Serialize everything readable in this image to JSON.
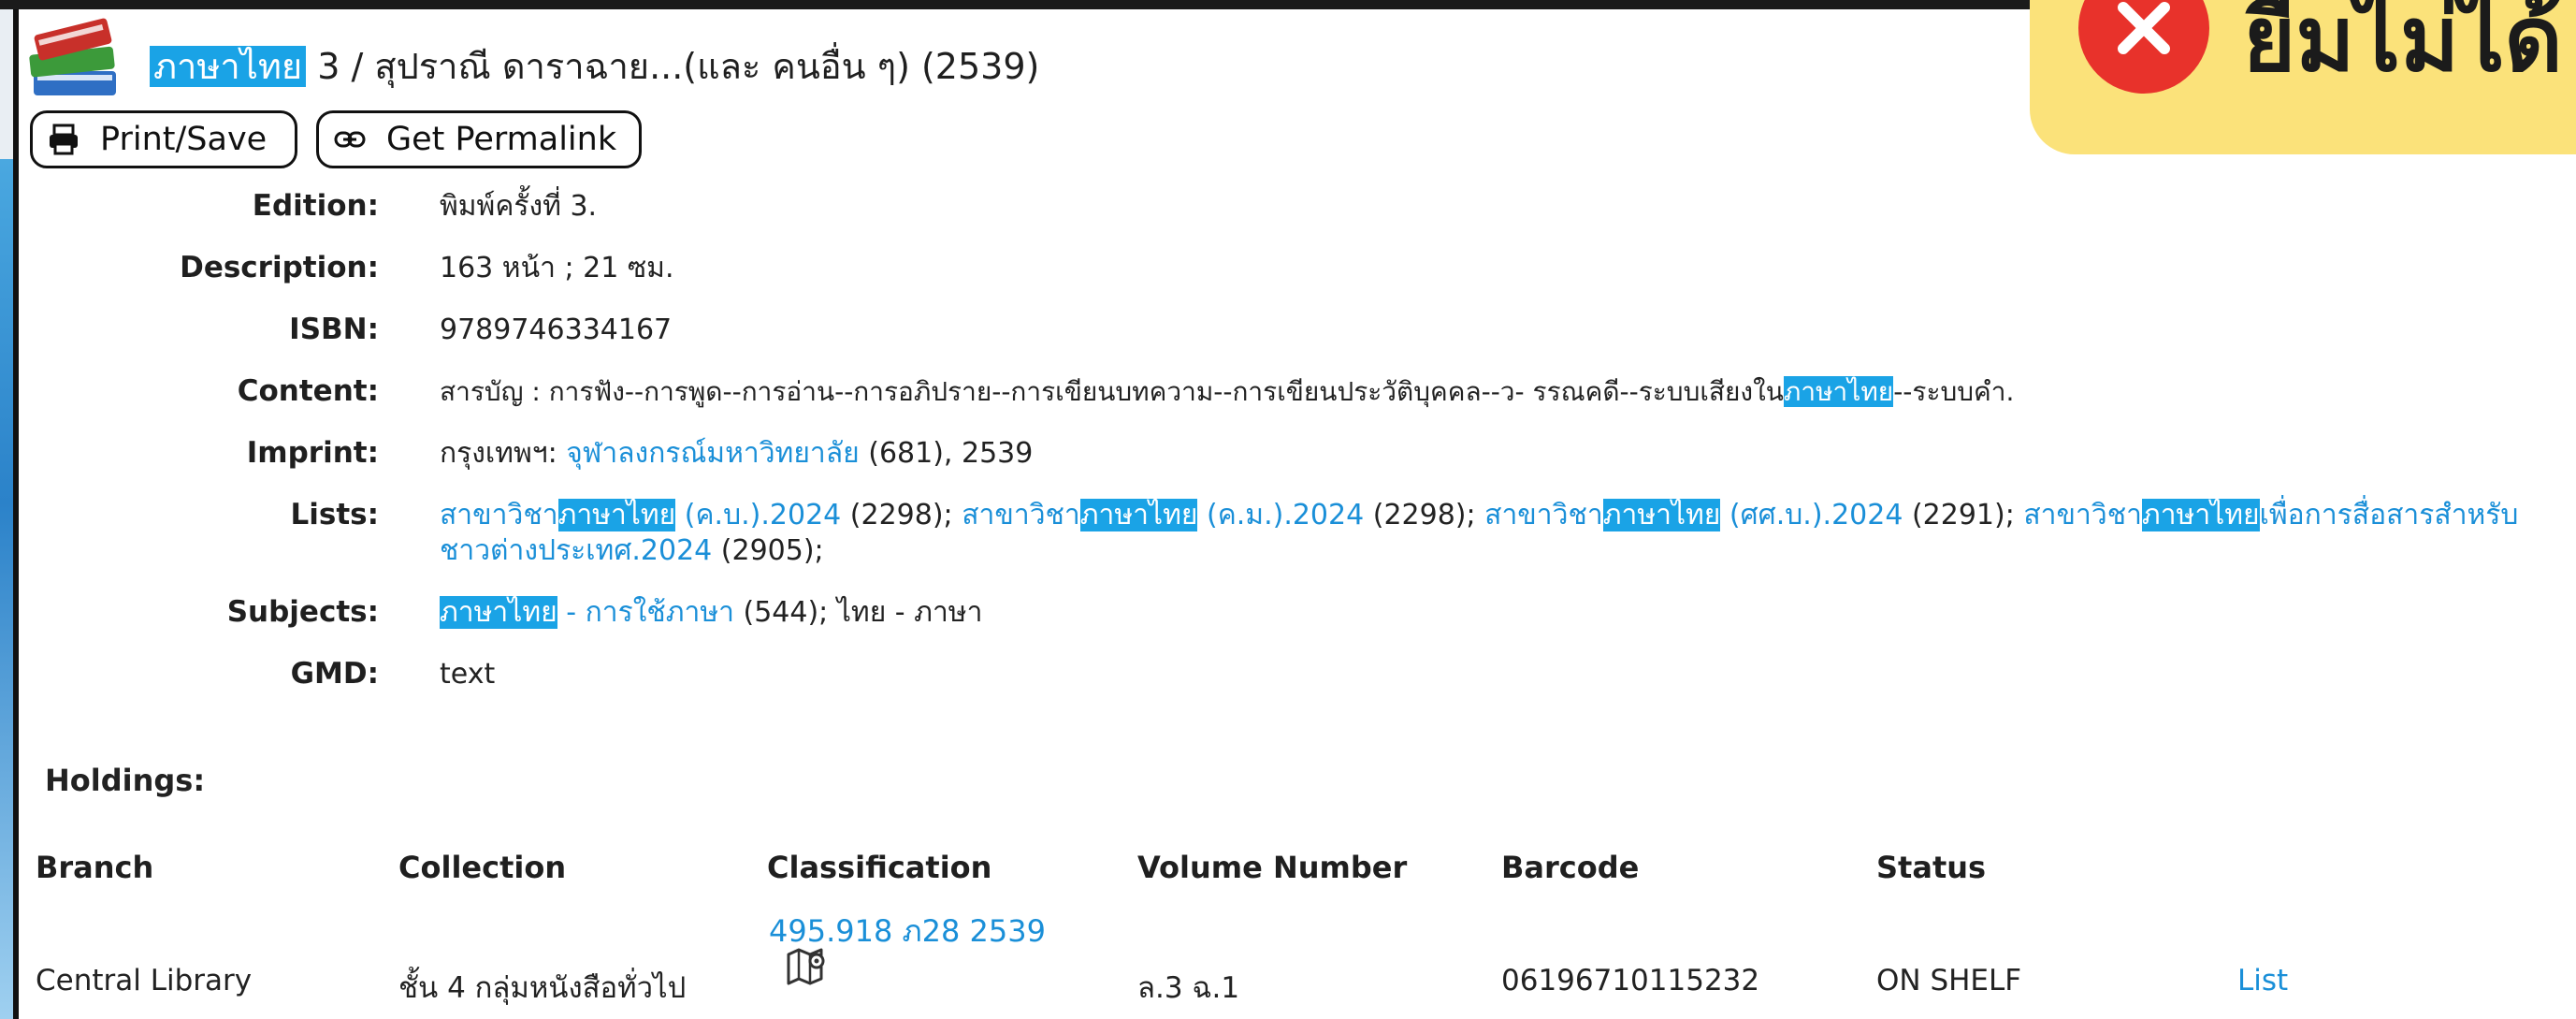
{
  "record": {
    "title_highlight": "ภาษาไทย",
    "title_rest": " 3  /  สุปราณี ดาราฉาย...(และ คนอื่น ๆ)  (2539)"
  },
  "buttons": {
    "print_label": "Print/Save",
    "permalink_label": "Get Permalink"
  },
  "fields": {
    "edition_label": "Edition:",
    "edition_value": "พิมพ์ครั้งที่ 3.",
    "description_label": "Description:",
    "description_value": "163 หน้า ; 21 ซม.",
    "isbn_label": "ISBN:",
    "isbn_value": "9789746334167",
    "content_label": "Content:",
    "content_value_pre": "สารบัญ : การฟัง--การพูด--การอ่าน--การอภิปราย--การเขียนบทความ--การเขียนประวัติบุคคล--ว- รรณคดี--ระบบเสียงใน",
    "content_value_hl": "ภาษาไทย",
    "content_value_post": "--ระบบคำ.",
    "imprint_label": "Imprint:",
    "imprint_pre": "กรุงเทพฯ: ",
    "imprint_link": "จุฬาลงกรณ์มหาวิทยาลัย",
    "imprint_post": "  (681), 2539",
    "lists_label": "Lists:",
    "lists": [
      {
        "pre": "สาขาวิชา",
        "hl": "ภาษาไทย",
        "post": " (ค.บ.).2024",
        "count": "   (2298); "
      },
      {
        "pre": "สาขาวิชา",
        "hl": "ภาษาไทย",
        "post": " (ค.ม.).2024",
        "count": "   (2298); "
      },
      {
        "pre": "สาขาวิชา",
        "hl": "ภาษาไทย",
        "post": " (ศศ.บ.).2024",
        "count": "   (2291); "
      },
      {
        "pre": "สาขาวิชา",
        "hl": "ภาษาไทย",
        "post": "เพื่อการสื่อสารสำหรับชาวต่างประเทศ.2024",
        "count": "   (2905);"
      }
    ],
    "subjects_label": "Subjects:",
    "subject1_hl": "ภาษาไทย",
    "subject1_link": " - การใช้ภาษา",
    "subject1_count": "   (544);  ",
    "subject2": "ไทย - ภาษา",
    "gmd_label": "GMD:",
    "gmd_value": "text"
  },
  "holdings": {
    "title": "Holdings:",
    "columns": [
      "Branch",
      "Collection",
      "Classification",
      "Volume Number",
      "Barcode",
      "Status"
    ],
    "row": {
      "branch": "Central Library",
      "collection": "ชั้น 4 กลุ่มหนังสือทั่วไป",
      "classification": "495.918 ภ28 2539",
      "volume": "ล.3 ฉ.1",
      "barcode": "06196710115232",
      "status": "ON SHELF",
      "action": "List"
    }
  },
  "badge": {
    "text": "ยืมไม่ได้"
  },
  "icons": [
    "books-icon",
    "printer-icon",
    "link-icon",
    "map-pin-icon",
    "close-circle-icon"
  ]
}
